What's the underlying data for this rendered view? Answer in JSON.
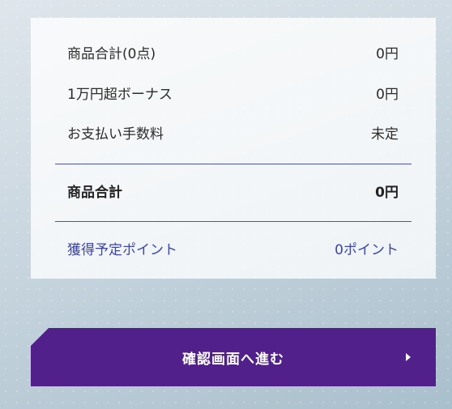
{
  "summary": {
    "items": [
      {
        "label": "商品合計(0点)",
        "value": "0円"
      },
      {
        "label": "1万円超ボーナス",
        "value": "0円"
      },
      {
        "label": "お支払い手数料",
        "value": "未定"
      }
    ],
    "total": {
      "label": "商品合計",
      "value": "0円"
    },
    "points": {
      "label": "獲得予定ポイント",
      "value": "0ポイント"
    }
  },
  "actions": {
    "confirm_label": "確認画面へ進む"
  },
  "colors": {
    "accent": "#51208a",
    "link": "#3b45a8",
    "divider": "#4b55b0"
  }
}
